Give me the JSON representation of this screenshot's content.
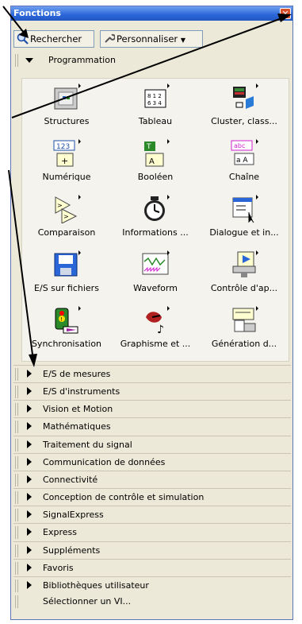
{
  "window": {
    "title": "Fonctions",
    "close_glyph": "✕"
  },
  "toolbar": {
    "search_label": "Rechercher",
    "customize_label": "Personnaliser"
  },
  "programming": {
    "label": "Programmation"
  },
  "tiles": [
    {
      "label": "Structures",
      "icon": "structures-icon"
    },
    {
      "label": "Tableau",
      "icon": "array-icon"
    },
    {
      "label": "Cluster, class...",
      "icon": "cluster-icon"
    },
    {
      "label": "Numérique",
      "icon": "numeric-icon"
    },
    {
      "label": "Booléen",
      "icon": "boolean-icon"
    },
    {
      "label": "Chaîne",
      "icon": "string-icon"
    },
    {
      "label": "Comparaison",
      "icon": "comparison-icon"
    },
    {
      "label": "Informations ...",
      "icon": "timing-icon"
    },
    {
      "label": "Dialogue et in...",
      "icon": "dialog-icon"
    },
    {
      "label": "E/S sur fichiers",
      "icon": "file-io-icon"
    },
    {
      "label": "Waveform",
      "icon": "waveform-icon"
    },
    {
      "label": "Contrôle d'ap...",
      "icon": "app-control-icon"
    },
    {
      "label": "Synchronisation",
      "icon": "synchronization-icon"
    },
    {
      "label": "Graphisme et ...",
      "icon": "graphics-icon"
    },
    {
      "label": "Génération d...",
      "icon": "report-generation-icon"
    }
  ],
  "categories": [
    "E/S de mesures",
    "E/S d'instruments",
    "Vision et Motion",
    "Mathématiques",
    "Traitement du signal",
    "Communication de données",
    "Connectivité",
    "Conception de contrôle et simulation",
    "SignalExpress",
    "Express",
    "Suppléments",
    "Favoris",
    "Bibliothèques utilisateur"
  ],
  "select_vi": {
    "label": "Sélectionner un VI..."
  },
  "colors": {
    "titlebar": "#2a66d8",
    "palette_bg": "#ece9d8",
    "close": "#d8502c"
  }
}
